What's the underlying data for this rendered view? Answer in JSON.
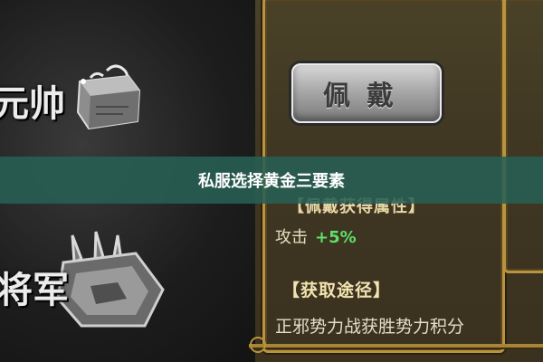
{
  "banner": {
    "title": "私服选择黄金三要素"
  },
  "ranks": [
    {
      "label": "元帅"
    },
    {
      "label": "将军"
    }
  ],
  "equip_button": {
    "label": "佩戴"
  },
  "attributes": {
    "heading": "【佩戴获得属性】",
    "stat_name": "攻击",
    "stat_value": "+5%"
  },
  "source": {
    "heading": "【获取途径】",
    "text": "正邪势力战获胜势力积分"
  },
  "colors": {
    "banner_bg": "#286054",
    "stat_value": "#5fe06a",
    "frame_gold": "#b8943f"
  }
}
